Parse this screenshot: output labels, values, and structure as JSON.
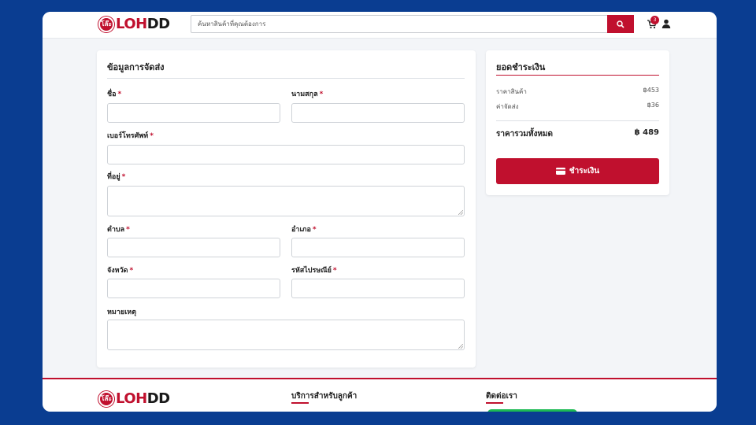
{
  "brand": {
    "badge": "โล๊ะ",
    "name_lo": "LOH",
    "name_dd": "DD"
  },
  "search": {
    "placeholder": "ค้นหาสินค้าที่คุณต้องการ"
  },
  "cart": {
    "count": "3"
  },
  "shipping": {
    "title": "ข้อมูลการจัดส่ง",
    "required_mark": "*",
    "fields": {
      "first_name": "ชื่อ",
      "last_name": "นามสกุล",
      "phone": "เบอร์โทรศัพท์",
      "address": "ที่อยู่",
      "subdistrict": "ตำบล",
      "district": "อำเภอ",
      "province": "จังหวัด",
      "postcode": "รหัสไปรษณีย์",
      "note": "หมายเหตุ"
    }
  },
  "summary": {
    "title": "ยอดชำระเงิน",
    "subtotal_label": "ราคาสินค้า",
    "subtotal_value": "฿453",
    "shipping_label": "ค่าจัดส่ง",
    "shipping_value": "฿36",
    "total_label": "ราคารวมทั้งหมด",
    "total_value": "฿ 489",
    "pay_label": "ชำระเงิน"
  },
  "footer": {
    "services_title": "บริการสำหรับลูกค้า",
    "contact_title": "ติดต่อเรา"
  },
  "colors": {
    "brand_red": "#c0102e",
    "frame_blue": "#0a3d91"
  }
}
